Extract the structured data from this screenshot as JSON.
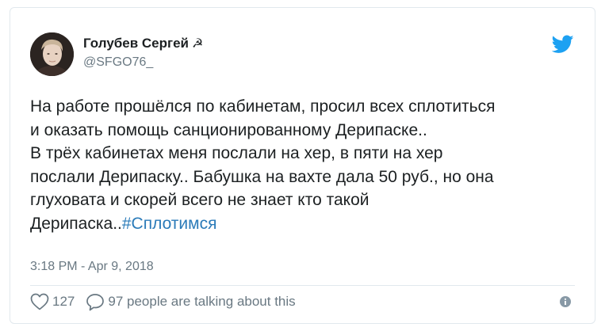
{
  "author": {
    "display_name": "Голубев Сергей",
    "badge": "☭",
    "handle": "@SFGO76_"
  },
  "tweet": {
    "lines": [
      "На работе прошёлся по кабинетам, просил всех сплотиться",
      "и оказать помощь санционированному Дерипаске..",
      "В трёх кабинетах меня послали на хер, в пяти на хер",
      "послали Дерипаску.. Бабушка на вахте дала 50 руб., но она",
      "глуховата и скорей всего не знает кто такой"
    ],
    "last_line_text": "Дерипаска..",
    "hashtag": "#Сплотимся"
  },
  "timestamp": "3:18 PM - Apr 9, 2018",
  "actions": {
    "likes_count": "127",
    "replies_text": "97 people are talking about this"
  },
  "colors": {
    "text": "#1c2022",
    "muted": "#697882",
    "link": "#2b7bb9",
    "twitter_blue": "#1da1f2",
    "border": "#e1e8ed"
  }
}
